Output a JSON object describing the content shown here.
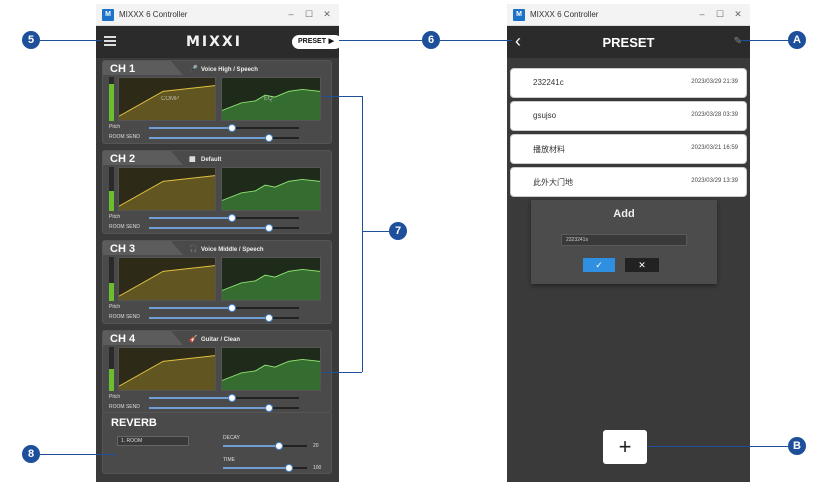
{
  "window": {
    "title": "MIXXX 6 Controller",
    "minimize": "–",
    "maximize": "☐",
    "close": "✕"
  },
  "left": {
    "logo": "MIXXI",
    "preset_button": "PRESET",
    "channels": [
      {
        "name": "CH 1",
        "mode": "Voice High / Speech",
        "mode_icon": "mic-icon",
        "comp_label": "COMP",
        "eq_label": "EQ",
        "meter_level": 0.85,
        "pitch": 0.55,
        "ratio": 0.8
      },
      {
        "name": "CH 2",
        "mode": "Default",
        "mode_icon": "keyboard-icon",
        "comp_label": "",
        "eq_label": "",
        "meter_level": 0.45,
        "pitch": 0.55,
        "ratio": 0.8
      },
      {
        "name": "CH 3",
        "mode": "Voice Middle / Speech",
        "mode_icon": "headphones-icon",
        "comp_label": "",
        "eq_label": "",
        "meter_level": 0.4,
        "pitch": 0.55,
        "ratio": 0.8
      },
      {
        "name": "CH 4",
        "mode": "Guitar / Clean",
        "mode_icon": "guitar-icon",
        "comp_label": "",
        "eq_label": "",
        "meter_level": 0.5,
        "pitch": 0.55,
        "ratio": 0.8
      }
    ],
    "slider_labels": {
      "pitch": "Pitch",
      "mix": "ROOM SEND"
    },
    "reverb": {
      "title": "REVERB",
      "type": "1. ROOM",
      "delay_label": "DECAY",
      "time_label": "TIME",
      "delay_val": "20",
      "time_val": "100"
    }
  },
  "right": {
    "title": "PRESET",
    "presets": [
      {
        "name": "232241c",
        "date": "2023/03/29 21:39"
      },
      {
        "name": "gsujso",
        "date": "2023/03/28 03:39"
      },
      {
        "name": "播放材料",
        "date": "2023/03/21 16:59"
      },
      {
        "name": "此外大门地",
        "date": "2023/03/29 13:39"
      }
    ],
    "dialog": {
      "title": "Add",
      "input_value": "2323241s",
      "ok": "✓",
      "cancel": "✕"
    },
    "add_symbol": "+"
  },
  "callouts": {
    "c5": "5",
    "c6": "6",
    "c7": "7",
    "c8": "8",
    "cA": "A",
    "cB": "B"
  }
}
